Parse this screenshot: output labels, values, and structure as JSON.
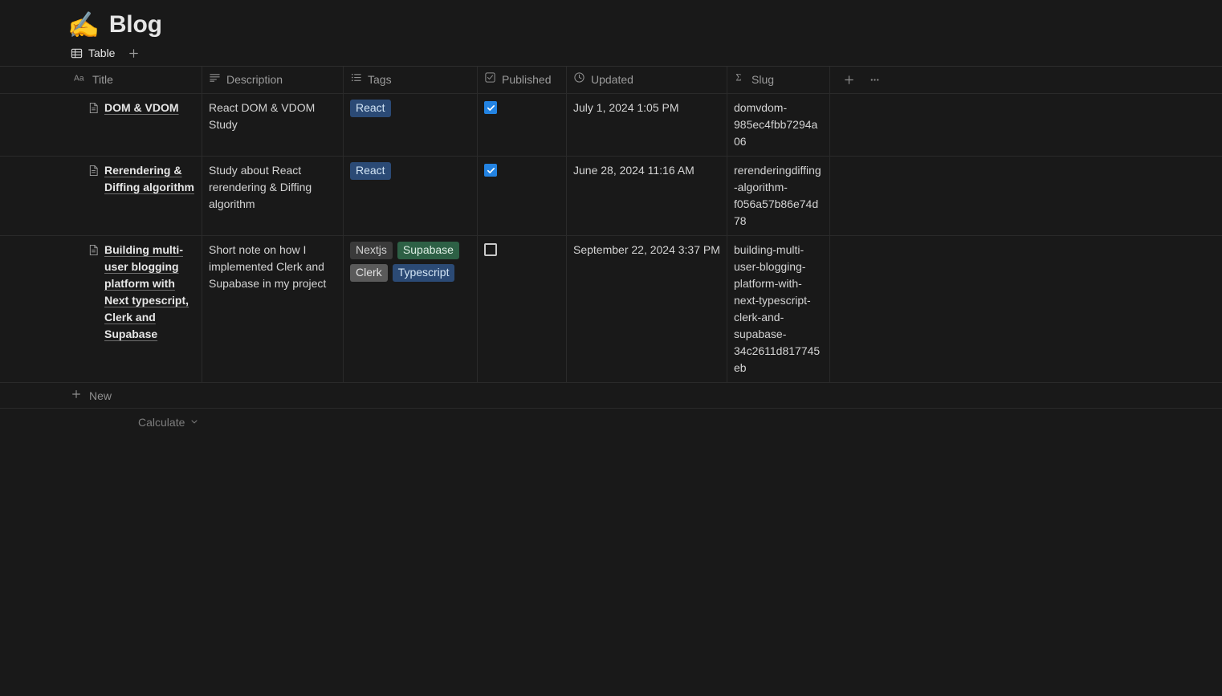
{
  "header": {
    "emoji": "✍️",
    "title": "Blog"
  },
  "tabs": {
    "items": [
      {
        "label": "Table",
        "icon": "table-icon",
        "active": true
      }
    ],
    "add_label": "+"
  },
  "table": {
    "columns": [
      {
        "key": "title",
        "label": "Title",
        "icon": "aa-text-icon"
      },
      {
        "key": "desc",
        "label": "Description",
        "icon": "text-lines-icon"
      },
      {
        "key": "tags",
        "label": "Tags",
        "icon": "bulleted-list-icon"
      },
      {
        "key": "published",
        "label": "Published",
        "icon": "checkbox-icon"
      },
      {
        "key": "updated",
        "label": "Updated",
        "icon": "clock-icon"
      },
      {
        "key": "slug",
        "label": "Slug",
        "icon": "formula-sigma-icon"
      }
    ],
    "header_actions": {
      "add_property": "+",
      "more_options": "···"
    },
    "rows": [
      {
        "title": "DOM & VDOM",
        "description": "React DOM & VDOM Study",
        "tags": [
          {
            "label": "React",
            "color": "blue"
          }
        ],
        "published": true,
        "updated": "July 1, 2024 1:05 PM",
        "slug": "domvdom-985ec4fbb7294a06"
      },
      {
        "title": "Rerendering & Diffing algorithm",
        "description": "Study about React rerendering & Diffing algorithm",
        "tags": [
          {
            "label": "React",
            "color": "blue"
          }
        ],
        "published": true,
        "updated": "June 28, 2024 11:16 AM",
        "slug": "rerenderingdiffing-algorithm-f056a57b86e74d78"
      },
      {
        "title": "Building multi-user blogging platform with Next typescript, Clerk and Supabase",
        "description": "Short note on how I implemented Clerk and Supabase in my project",
        "tags": [
          {
            "label": "Nextjs",
            "color": "gray"
          },
          {
            "label": "Supabase",
            "color": "green"
          },
          {
            "label": "Clerk",
            "color": "gray2"
          },
          {
            "label": "Typescript",
            "color": "blue"
          }
        ],
        "published": false,
        "updated": "September 22, 2024 3:37 PM",
        "slug": "building-multi-user-blogging-platform-with-next-typescript-clerk-and-supabase-34c2611d817745eb"
      }
    ],
    "new_row_label": "New",
    "calculate_label": "Calculate"
  },
  "colors": {
    "background": "#191919",
    "accent_blue": "#2383e2",
    "tag_blue": "#2b4a75",
    "tag_green": "#2d6045",
    "tag_gray": "#3a3a3a",
    "tag_gray2": "#5a5a5a",
    "border": "#2a2a2a"
  }
}
